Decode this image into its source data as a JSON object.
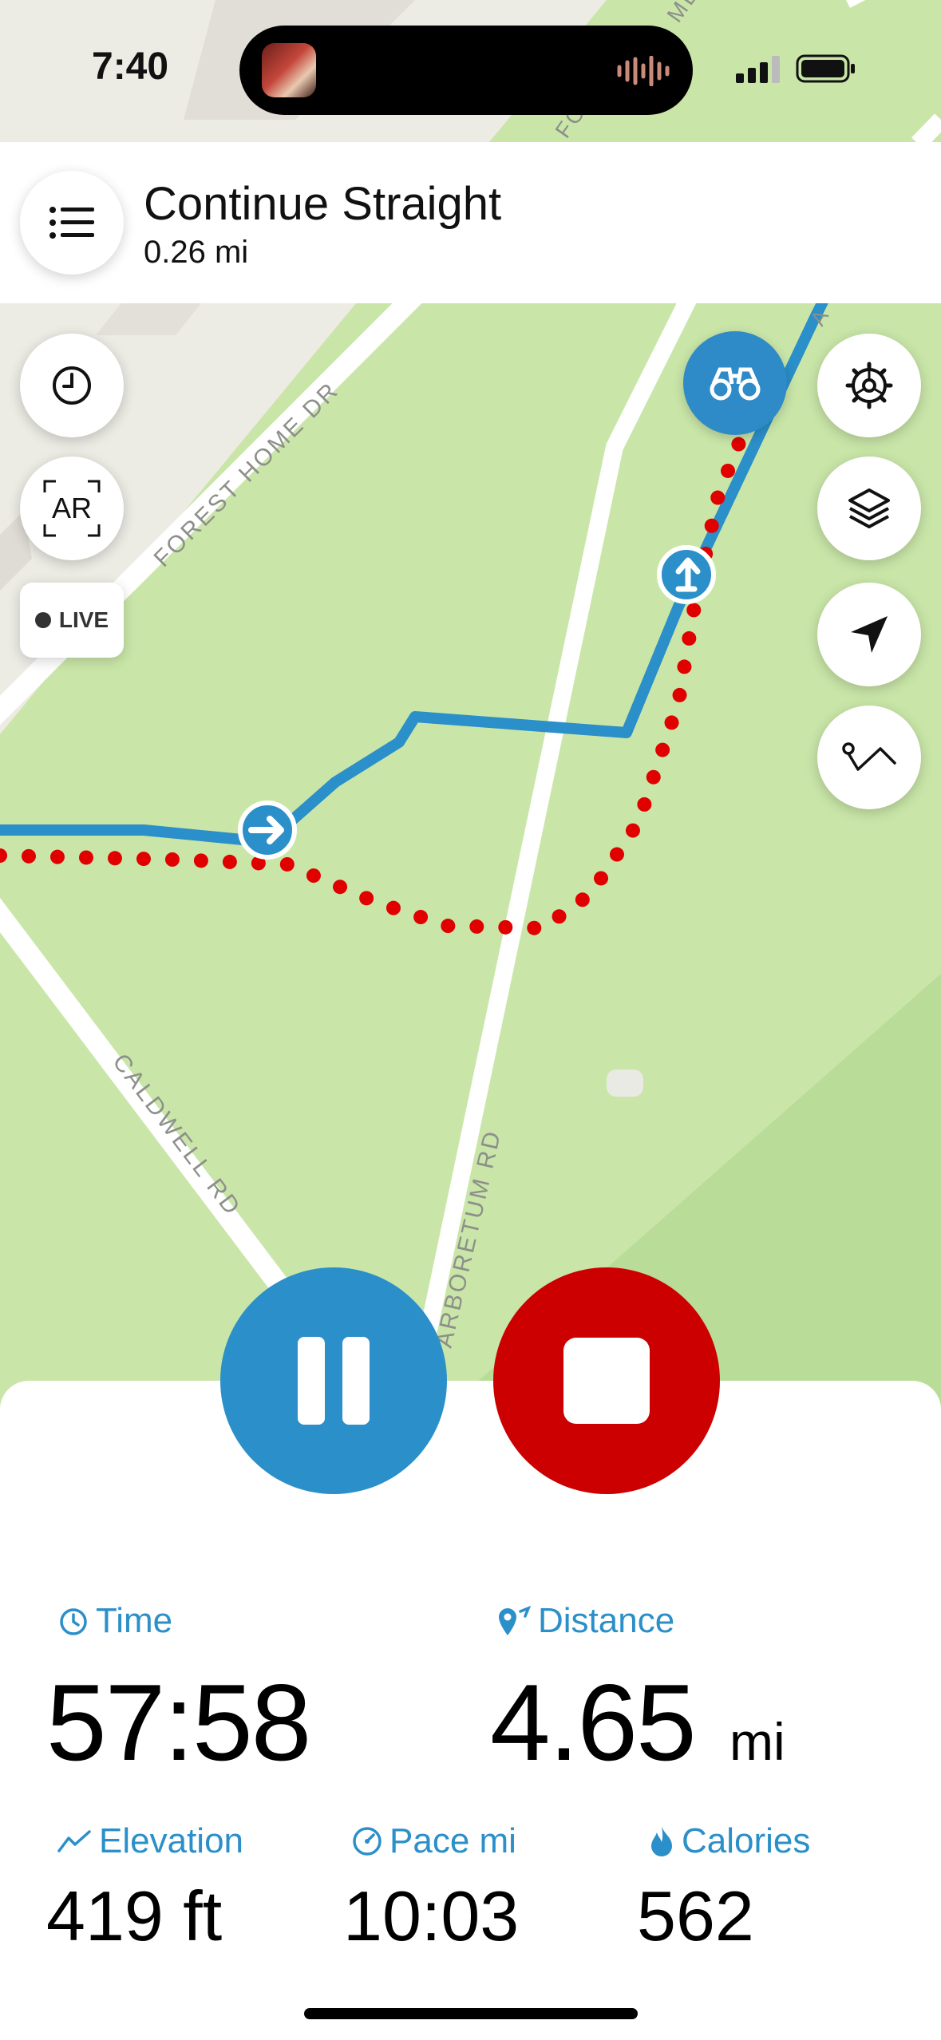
{
  "status_bar": {
    "time": "7:40"
  },
  "navigation": {
    "instruction": "Continue Straight",
    "distance": "0.26 mi"
  },
  "map": {
    "road_labels": [
      "FOREST HOME DR",
      "CALDWELL RD",
      "ARBORETUM RD",
      "FOR",
      "ME D",
      "A"
    ]
  },
  "controls": {
    "live_label": "LIVE",
    "ar_label": "AR"
  },
  "stats": {
    "time_label": "Time",
    "time_value": "57:58",
    "distance_label": "Distance",
    "distance_value": "4.65",
    "distance_unit": "mi",
    "elevation_label": "Elevation",
    "elevation_value": "419 ft",
    "pace_label": "Pace mi",
    "pace_value": "10:03",
    "calories_label": "Calories",
    "calories_value": "562"
  },
  "colors": {
    "accent_blue": "#2b8fc9",
    "stop_red": "#cc0000",
    "map_green": "#c9e6a8",
    "route_red": "#e00000"
  }
}
